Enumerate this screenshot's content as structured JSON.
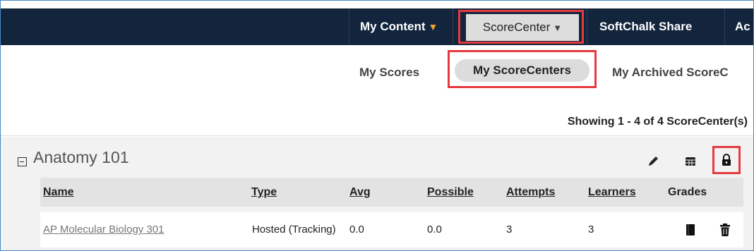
{
  "topnav": {
    "my_content": "My Content",
    "scorecenter": "ScoreCenter",
    "softchalk_share": "SoftChalk Share",
    "cut_item": "Ac"
  },
  "subnav": {
    "my_scores": "My Scores",
    "my_scorecenters": "My ScoreCenters",
    "archived": "My Archived ScoreC"
  },
  "showing": "Showing 1 - 4 of 4 ScoreCenter(s)",
  "group": {
    "title": "Anatomy 101",
    "icons": [
      "edit-pencil-icon",
      "grid-table-icon",
      "lock-icon"
    ]
  },
  "table": {
    "headers": {
      "name": "Name",
      "type": "Type",
      "avg": "Avg",
      "possible": "Possible",
      "attempts": "Attempts",
      "learners": "Learners",
      "grades": "Grades"
    },
    "rows": [
      {
        "name": "AP Molecular Biology 301",
        "type": "Hosted (Tracking)",
        "avg": "0.0",
        "possible": "0.0",
        "attempts": "3",
        "learners": "3"
      }
    ]
  },
  "colors": {
    "nav_bg": "#13243d",
    "highlight_red": "#e53a40",
    "dropdown_orange": "#f0a030"
  }
}
